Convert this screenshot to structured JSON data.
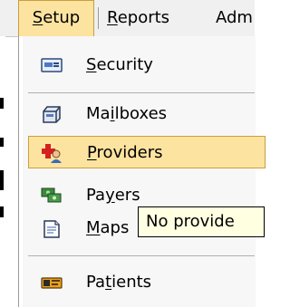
{
  "menubar": {
    "setup": {
      "prefix": "",
      "mnemonic": "S",
      "rest": "etup"
    },
    "reports": {
      "prefix": "",
      "mnemonic": "R",
      "rest": "eports"
    },
    "admin": {
      "text": "Adm"
    }
  },
  "menu": {
    "items": [
      {
        "prefix": "",
        "mnemonic": "S",
        "rest": "ecurity",
        "icon": "security-icon"
      },
      {
        "prefix": "Ma",
        "mnemonic": "i",
        "rest": "lboxes",
        "icon": "mailbox-icon"
      },
      {
        "prefix": "",
        "mnemonic": "P",
        "rest": "roviders",
        "icon": "providers-icon",
        "highlighted": true
      },
      {
        "prefix": "Pa",
        "mnemonic": "y",
        "rest": "ers",
        "icon": "payers-icon"
      },
      {
        "prefix": "",
        "mnemonic": "M",
        "rest": "aps",
        "icon": "maps-icon"
      },
      {
        "prefix": "Pa",
        "mnemonic": "t",
        "rest": "ients",
        "icon": "patients-icon"
      }
    ]
  },
  "tooltip": {
    "text": "No provide"
  },
  "colors": {
    "highlight": "#fce3a0",
    "highlight_border": "#c8a040",
    "tooltip_bg": "#ffffe1"
  }
}
